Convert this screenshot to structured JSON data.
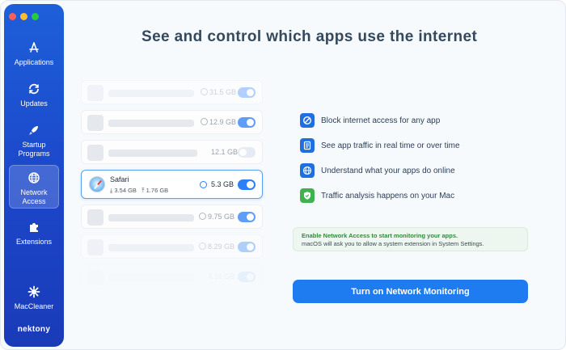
{
  "sidebar": {
    "items": [
      {
        "label": "Applications",
        "icon": "app-store-icon"
      },
      {
        "label": "Updates",
        "icon": "refresh-icon"
      },
      {
        "label": "Startup Programs",
        "icon": "rocket-icon"
      },
      {
        "label": "Network Access",
        "icon": "globe-icon",
        "active": true
      },
      {
        "label": "Extensions",
        "icon": "puzzle-icon"
      },
      {
        "label": "MacCleaner",
        "icon": "gear-icon"
      }
    ],
    "brand": "nektony"
  },
  "headline": "See and control which apps use the internet",
  "apps": [
    {
      "size": "31.5 GB",
      "enabled": true
    },
    {
      "size": "12.9 GB",
      "enabled": true
    },
    {
      "size": "12.1 GB",
      "enabled": false
    },
    {
      "name": "Safari",
      "download": "3.54 GB",
      "upload": "1.76 GB",
      "size": "5.3 GB",
      "enabled": true
    },
    {
      "size": "9.75 GB",
      "enabled": true
    },
    {
      "size": "8.29 GB",
      "enabled": true
    },
    {
      "size": "4.16 GB",
      "enabled": true
    }
  ],
  "features": [
    {
      "text": "Block internet access for any app",
      "icon": "block-icon"
    },
    {
      "text": "See app traffic in real time or over time",
      "icon": "document-icon"
    },
    {
      "text": "Understand what your apps do online",
      "icon": "globe-icon"
    },
    {
      "text": "Traffic analysis happens on your Mac",
      "icon": "shield-check-icon"
    }
  ],
  "notice": {
    "title": "Enable Network Access to start monitoring your apps.",
    "subtitle": "macOS will ask you to allow a system extension in System Settings."
  },
  "cta_label": "Turn on Network Monitoring",
  "colors": {
    "accent": "#1e7cf0",
    "sidebar": "#1e5fd9",
    "notice_green": "#2e8a3e"
  }
}
